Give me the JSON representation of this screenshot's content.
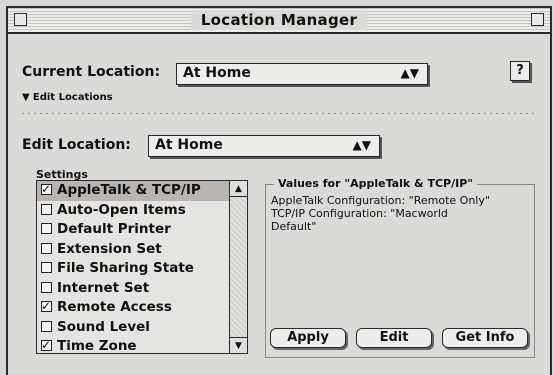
{
  "window": {
    "title": "Location Manager"
  },
  "current_location": {
    "label": "Current Location:",
    "value": "At Home"
  },
  "help_button": {
    "label": "?"
  },
  "edit_locations": {
    "label": "Edit Locations"
  },
  "edit_location": {
    "label": "Edit Location:",
    "value": "At Home"
  },
  "settings": {
    "label": "Settings",
    "items": [
      {
        "label": "AppleTalk & TCP/IP",
        "checked": true,
        "selected": true
      },
      {
        "label": "Auto-Open Items",
        "checked": false,
        "selected": false
      },
      {
        "label": "Default Printer",
        "checked": false,
        "selected": false
      },
      {
        "label": "Extension Set",
        "checked": false,
        "selected": false
      },
      {
        "label": "File Sharing State",
        "checked": false,
        "selected": false
      },
      {
        "label": "Internet Set",
        "checked": false,
        "selected": false
      },
      {
        "label": "Remote Access",
        "checked": true,
        "selected": false
      },
      {
        "label": "Sound Level",
        "checked": false,
        "selected": false
      },
      {
        "label": "Time Zone",
        "checked": true,
        "selected": false
      }
    ]
  },
  "values": {
    "title": "Values for \"AppleTalk & TCP/IP\"",
    "lines": [
      "AppleTalk Configuration: \"Remote Only\"",
      "TCP/IP Configuration: \"Macworld",
      "Default\""
    ]
  },
  "buttons": {
    "apply": "Apply",
    "edit": "Edit",
    "get_info": "Get Info"
  },
  "colors": {
    "window_bg": "#dcdad6",
    "frame": "#2a2a2a",
    "selection": "#b8b5b0"
  }
}
